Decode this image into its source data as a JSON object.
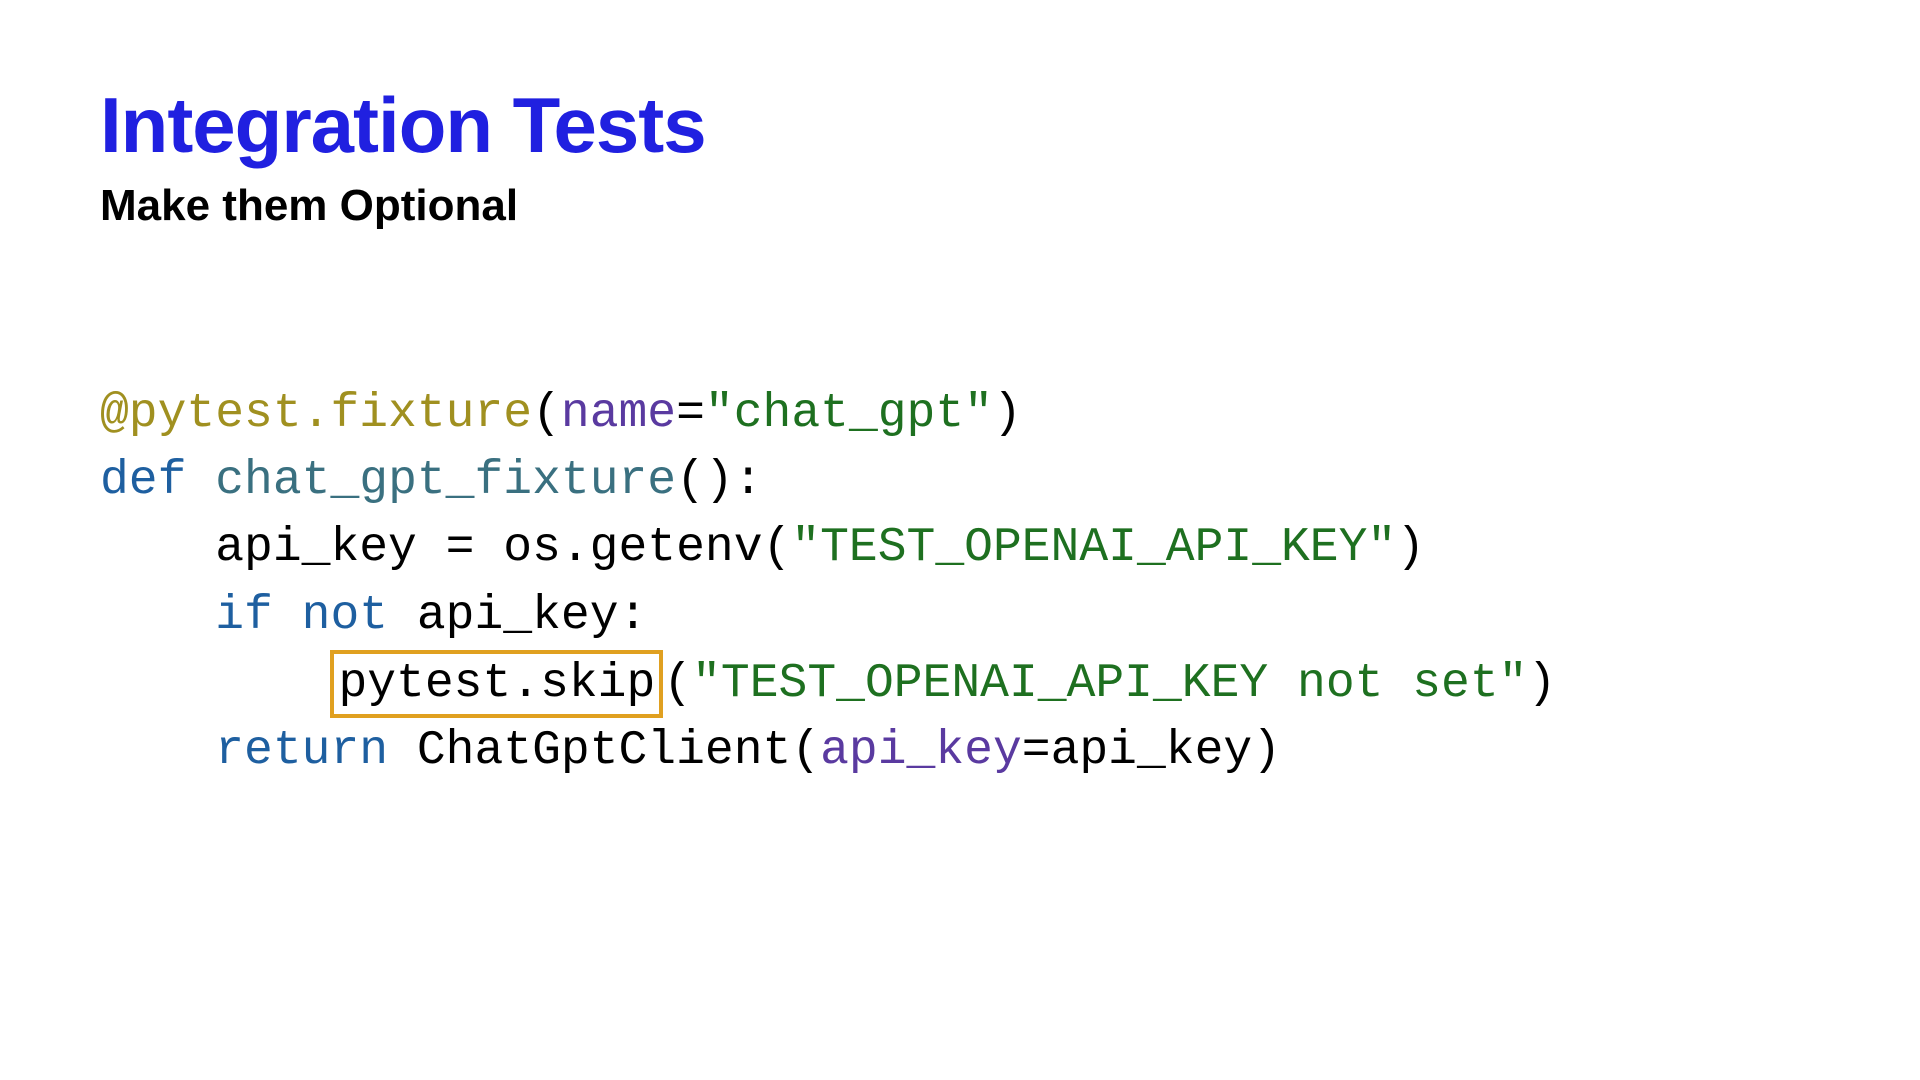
{
  "header": {
    "title": "Integration Tests",
    "subtitle": "Make them Optional"
  },
  "code": {
    "line1": {
      "decorator": "@pytest.fixture",
      "paren_open": "(",
      "param_name": "name",
      "equals": "=",
      "param_value": "\"chat_gpt\"",
      "paren_close": ")"
    },
    "line2": {
      "def_kw": "def",
      "space1": " ",
      "func_name": "chat_gpt_fixture",
      "parens": "():"
    },
    "line3": {
      "indent": "    ",
      "var": "api_key = os.getenv(",
      "string": "\"TEST_OPENAI_API_KEY\"",
      "close": ")"
    },
    "line4": {
      "indent": "    ",
      "if_kw": "if",
      "space": " ",
      "not_kw": "not",
      "rest": " api_key:"
    },
    "line5": {
      "indent": "        ",
      "highlighted": "pytest.skip",
      "paren_open": "(",
      "string": "\"TEST_OPENAI_API_KEY not set\"",
      "paren_close": ")"
    },
    "line6": {
      "indent": "    ",
      "return_kw": "return",
      "rest1": " ChatGptClient(",
      "param": "api_key",
      "rest2": "=api_key)"
    }
  }
}
